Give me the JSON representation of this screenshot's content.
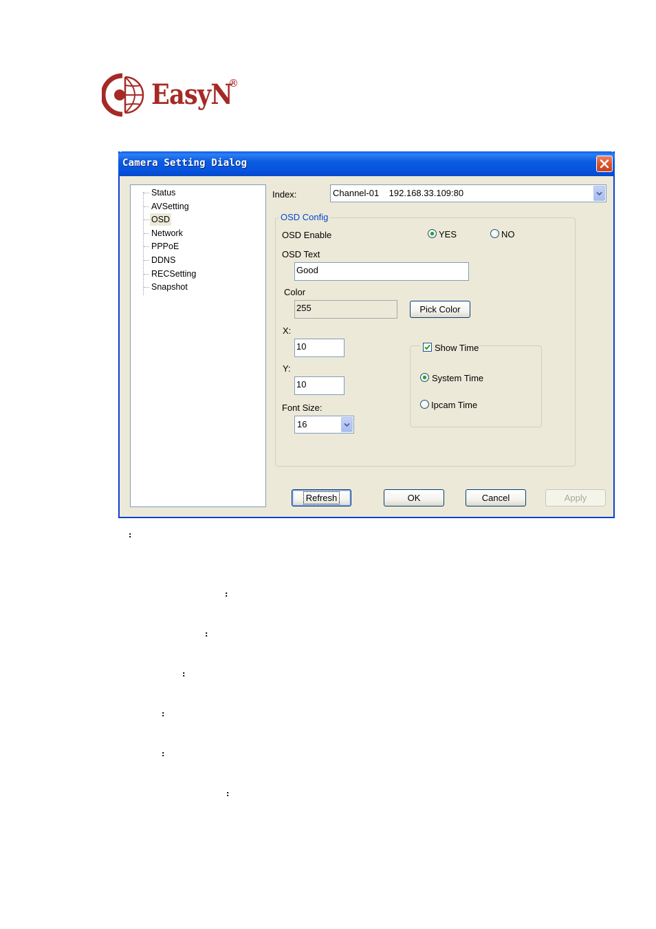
{
  "logo": {
    "brand": "EasyN",
    "registered_mark": "®",
    "color": "#a52a25"
  },
  "dialog": {
    "title": "Camera Setting Dialog",
    "close_icon": "close-x-icon",
    "tree": {
      "items": [
        {
          "label": "Status",
          "selected": false
        },
        {
          "label": "AVSetting",
          "selected": false
        },
        {
          "label": "OSD",
          "selected": true
        },
        {
          "label": "Network",
          "selected": false
        },
        {
          "label": "PPPoE",
          "selected": false
        },
        {
          "label": "DDNS",
          "selected": false
        },
        {
          "label": "RECSetting",
          "selected": false
        },
        {
          "label": "Snapshot",
          "selected": false
        }
      ]
    },
    "index": {
      "label": "Index:",
      "value": "Channel-01    192.168.33.109:80"
    },
    "osd_config": {
      "title": "OSD Config",
      "title_color": "#0046d5",
      "enable": {
        "label": "OSD Enable",
        "options": [
          "YES",
          "NO"
        ],
        "selected": "YES"
      },
      "osd_text": {
        "label": "OSD Text",
        "value": "Good"
      },
      "color": {
        "label": "Color",
        "value": "255",
        "pick_button": "Pick Color"
      },
      "x": {
        "label": "X:",
        "value": "10"
      },
      "y": {
        "label": "Y:",
        "value": "10"
      },
      "font_size": {
        "label": "Font Size:",
        "value": "16"
      },
      "show_time": {
        "label": "Show Time",
        "checked": true,
        "options": [
          "System Time",
          "Ipcam Time"
        ],
        "selected": "System Time"
      }
    },
    "buttons": {
      "refresh": "Refresh",
      "ok": "OK",
      "cancel": "Cancel",
      "apply": "Apply"
    }
  },
  "document": {
    "colon_markers": [
      ":",
      ":",
      ":",
      ":",
      ":",
      ":",
      ":"
    ]
  }
}
